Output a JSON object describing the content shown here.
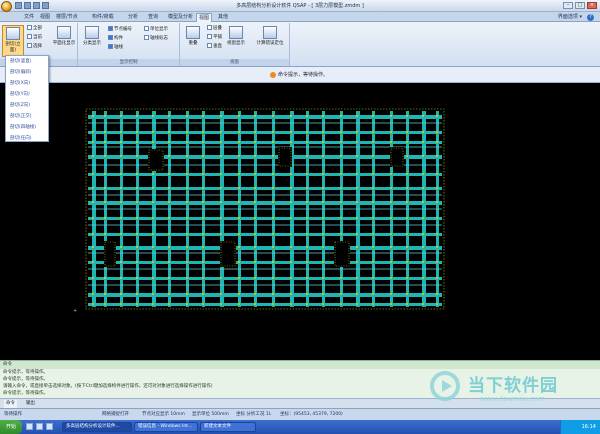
{
  "window": {
    "title": "多高层结构分析设计软件 QSAP - [ 3层力层模型.zmdm ]",
    "buttons": [
      "–",
      "□",
      "×"
    ]
  },
  "ribbon_tabs": [
    "文件",
    "视图",
    "楼层/节点",
    "构件/荷载",
    "分析",
    "查询",
    "模型及分析",
    "视图",
    "其他"
  ],
  "style_label": "界面选项 ▾",
  "ribbon": {
    "groups": [
      "视图",
      "显示控制",
      "视窗"
    ],
    "cut_label": "剖切(立面)",
    "show_all": "全部",
    "show_current": "当前",
    "show_selected": "选择",
    "plan": "平面化显示",
    "layer_show": "分类显示",
    "chk_node_label": "节点编号",
    "chk_member": "构件",
    "chk_grid": "轴线",
    "chk_unit_num": "单位显示",
    "chk_axis_mark": "轴线标志",
    "tile": "重叠",
    "cascade": "层叠",
    "horiz": "平铺",
    "vert": "垂直",
    "win_view": "视窗显示",
    "calc_locate": "计算错误定位"
  },
  "dropdown_items": [
    "剖切(竖直)",
    "剖切(偏斜)",
    "剖切(X向)",
    "剖切(Y向)",
    "剖切(Z向)",
    "剖切(正交)",
    "剖切(四轴线)",
    "剖切(任向)"
  ],
  "info_message": "命令提示，等待操作。",
  "command": {
    "header": "命令",
    "lines": [
      "命令提示，等待操作。",
      "命令提示，等待操作。",
      "请输入命令，或直接单击选择对象。(按下Ctrl键加选择构件进行操作，还可对对象进行选择操作进行操作)",
      "命令提示，等待操作。"
    ],
    "tabs": [
      "命令",
      "输出"
    ]
  },
  "status": {
    "left": "等待操作",
    "items": [
      "网格捕捉打开",
      "节点对应显示 10mm",
      "显示单位 500mm",
      "坐标 分析工况 1L",
      "坐标：(95453, 45379, 7200)"
    ]
  },
  "taskbar": {
    "start": "开始",
    "items": [
      "多高层结构分析设计软件...",
      "错误信息 - Windows Int...",
      "新建文本文件"
    ],
    "clock": "16:14"
  },
  "watermark": {
    "brand": "当下软件园",
    "url": "www.downxia.com"
  },
  "colors": {
    "beam": "#1fb5b5",
    "column": "#c9c900",
    "canvas": "#000000"
  }
}
